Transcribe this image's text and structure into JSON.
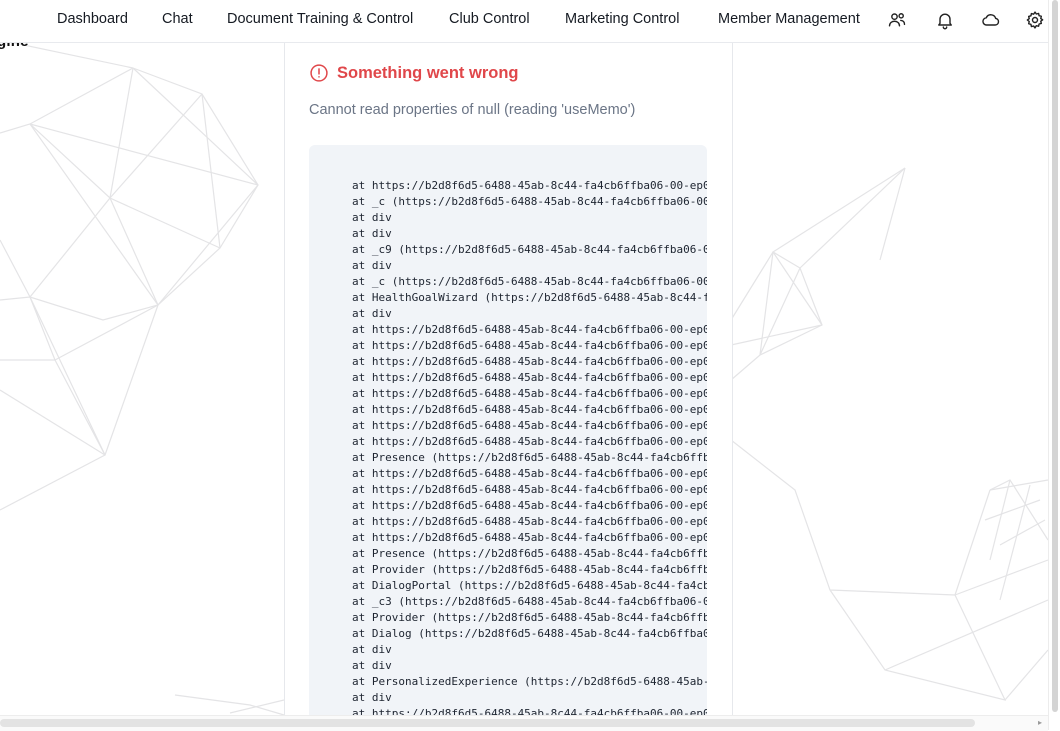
{
  "brand": {
    "text": "gine",
    "dot": "•"
  },
  "nav": {
    "items": [
      {
        "label": "Dashboard"
      },
      {
        "label": "Chat"
      },
      {
        "label": "Document Training & Control"
      },
      {
        "label": "Club Control"
      },
      {
        "label": "Marketing Control"
      },
      {
        "label": "Member Management"
      }
    ],
    "icons": [
      "users-icon",
      "bell-icon",
      "cloud-icon",
      "gear-icon"
    ]
  },
  "error": {
    "title": "Something went wrong",
    "message": "Cannot read properties of null (reading 'useMemo')",
    "icon": "alert-circle-icon",
    "color": "#e0474a",
    "stack": [
      "at https://b2d8f6d5-6488-45ab-8c44-fa4cb6ffba06-00-ep0",
      "at _c (https://b2d8f6d5-6488-45ab-8c44-fa4cb6ffba06-00",
      "at div",
      "at div",
      "at _c9 (https://b2d8f6d5-6488-45ab-8c44-fa4cb6ffba06-0",
      "at div",
      "at _c (https://b2d8f6d5-6488-45ab-8c44-fa4cb6ffba06-00",
      "at HealthGoalWizard (https://b2d8f6d5-6488-45ab-8c44-f",
      "at div",
      "at https://b2d8f6d5-6488-45ab-8c44-fa4cb6ffba06-00-ep0",
      "at https://b2d8f6d5-6488-45ab-8c44-fa4cb6ffba06-00-ep0",
      "at https://b2d8f6d5-6488-45ab-8c44-fa4cb6ffba06-00-ep0",
      "at https://b2d8f6d5-6488-45ab-8c44-fa4cb6ffba06-00-ep0",
      "at https://b2d8f6d5-6488-45ab-8c44-fa4cb6ffba06-00-ep0",
      "at https://b2d8f6d5-6488-45ab-8c44-fa4cb6ffba06-00-ep0",
      "at https://b2d8f6d5-6488-45ab-8c44-fa4cb6ffba06-00-ep0",
      "at https://b2d8f6d5-6488-45ab-8c44-fa4cb6ffba06-00-ep0",
      "at Presence (https://b2d8f6d5-6488-45ab-8c44-fa4cb6ffb",
      "at https://b2d8f6d5-6488-45ab-8c44-fa4cb6ffba06-00-ep0",
      "at https://b2d8f6d5-6488-45ab-8c44-fa4cb6ffba06-00-ep0",
      "at https://b2d8f6d5-6488-45ab-8c44-fa4cb6ffba06-00-ep0",
      "at https://b2d8f6d5-6488-45ab-8c44-fa4cb6ffba06-00-ep0",
      "at https://b2d8f6d5-6488-45ab-8c44-fa4cb6ffba06-00-ep0",
      "at Presence (https://b2d8f6d5-6488-45ab-8c44-fa4cb6ffb",
      "at Provider (https://b2d8f6d5-6488-45ab-8c44-fa4cb6ffb",
      "at DialogPortal (https://b2d8f6d5-6488-45ab-8c44-fa4cb",
      "at _c3 (https://b2d8f6d5-6488-45ab-8c44-fa4cb6ffba06-0",
      "at Provider (https://b2d8f6d5-6488-45ab-8c44-fa4cb6ffb",
      "at Dialog (https://b2d8f6d5-6488-45ab-8c44-fa4cb6ffba0",
      "at div",
      "at div",
      "at PersonalizedExperience (https://b2d8f6d5-6488-45ab-",
      "at div",
      "at https://b2d8f6d5-6488-45ab-8c44-fa4cb6ffba06-00-ep0"
    ]
  },
  "scrollbar": {
    "right_glyph": "▸"
  }
}
